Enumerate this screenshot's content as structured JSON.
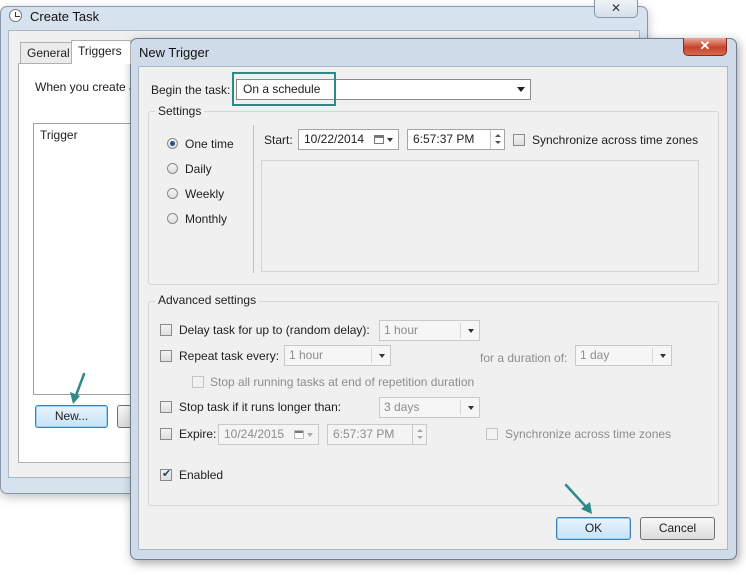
{
  "create_task": {
    "title": "Create Task",
    "close_label": "✕",
    "tabs": [
      {
        "label": "General"
      },
      {
        "label": "Triggers"
      }
    ],
    "description": "When you create a",
    "list_column": "Trigger",
    "new_button": "New..."
  },
  "new_trigger": {
    "title": "New Trigger",
    "close_label": "✕",
    "begin_label": "Begin the task:",
    "begin_value": "On a schedule",
    "settings": {
      "legend": "Settings",
      "schedule_options": [
        "One time",
        "Daily",
        "Weekly",
        "Monthly"
      ],
      "selected": "One time",
      "start_label": "Start:",
      "start_date": "10/22/2014",
      "start_time": "6:57:37 PM",
      "sync_label": "Synchronize across time zones"
    },
    "advanced": {
      "legend": "Advanced settings",
      "delay_label": "Delay task for up to (random delay):",
      "delay_value": "1 hour",
      "repeat_label": "Repeat task every:",
      "repeat_value": "1 hour",
      "duration_label": "for a duration of:",
      "duration_value": "1 day",
      "stop_running_label": "Stop all running tasks at end of repetition duration",
      "stop_longer_label": "Stop task if it runs longer than:",
      "stop_longer_value": "3 days",
      "expire_label": "Expire:",
      "expire_date": "10/24/2015",
      "expire_time": "6:57:37 PM",
      "expire_sync_label": "Synchronize across time zones",
      "enabled_label": "Enabled",
      "enabled_checked": true
    },
    "ok_button": "OK",
    "cancel_button": "Cancel"
  },
  "colors": {
    "annotation": "#2e8a8a",
    "close_button": "#c7432b",
    "title_bar": "#cfdbe8"
  }
}
